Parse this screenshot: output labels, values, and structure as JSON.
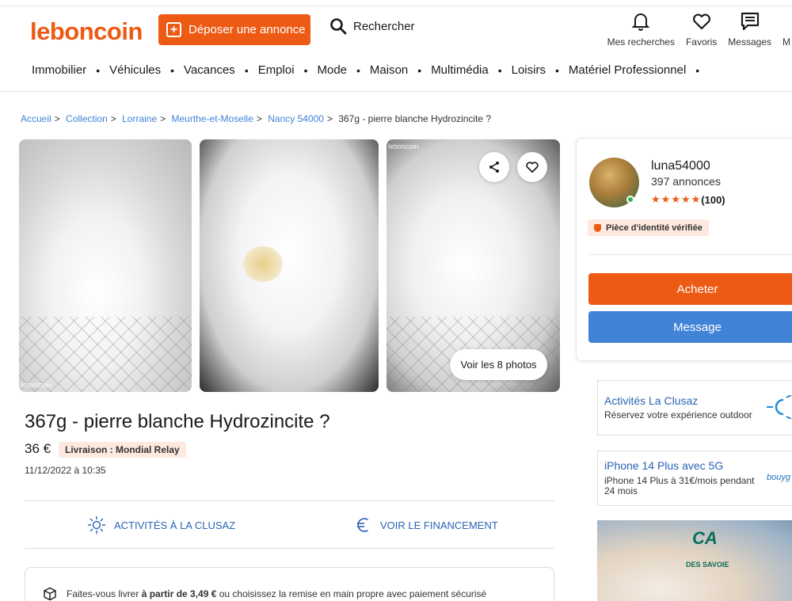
{
  "header": {
    "logo": "leboncoin",
    "deposit_label": "Déposer une annonce",
    "search_label": "Rechercher",
    "icons": [
      {
        "icon": "bell-icon",
        "label": "Mes recherches"
      },
      {
        "icon": "heart-icon",
        "label": "Favoris"
      },
      {
        "icon": "message-icon",
        "label": "Messages"
      },
      {
        "icon": "user-icon",
        "label": "M"
      }
    ]
  },
  "nav": [
    "Immobilier",
    "Véhicules",
    "Vacances",
    "Emploi",
    "Mode",
    "Maison",
    "Multimédia",
    "Loisirs",
    "Matériel Professionnel"
  ],
  "breadcrumb": [
    "Accueil",
    "Collection",
    "Lorraine",
    "Meurthe-et-Moselle",
    "Nancy 54000"
  ],
  "breadcrumb_current": "367g - pierre blanche Hydrozincite ?",
  "photos": {
    "watermark": "leboncoin",
    "see_all": "Voir les 8 photos"
  },
  "listing": {
    "title": "367g - pierre blanche Hydrozincite ?",
    "price": "36 €",
    "delivery_tag": "Livraison : Mondial Relay",
    "date": "11/12/2022 à 10:35",
    "promo_1": "Activités à la Clusaz",
    "promo_2": "Voir le financement",
    "delivery_prefix": "Faites-vous livrer ",
    "delivery_bold": "à partir de 3,49 €",
    "delivery_suffix": " ou choisissez la remise en main propre avec paiement sécurisé"
  },
  "seller": {
    "name": "luna54000",
    "count": "397 annonces",
    "rating_count": "(100)",
    "verified": "Pièce d'identité vérifiée",
    "buy_label": "Acheter",
    "message_label": "Message"
  },
  "ads": [
    {
      "title": "Activités La Clusaz",
      "subtitle": "Réservez votre expérience outdoor"
    },
    {
      "title": "iPhone 14 Plus avec 5G",
      "subtitle": "iPhone 14 Plus à 31€/mois pendant 24 mois",
      "brand": "bouyg"
    }
  ],
  "ad_banner": {
    "logo": "CA",
    "sub": "DES SAVOIE"
  },
  "colors": {
    "brand": "#ec5a13",
    "blue": "#4183d7",
    "link": "#2b64b5"
  }
}
